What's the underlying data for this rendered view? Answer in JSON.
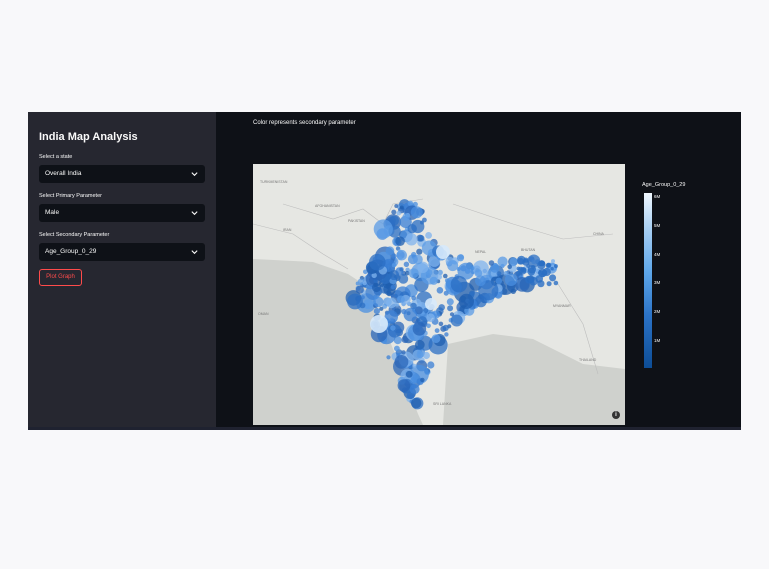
{
  "sidebar": {
    "title": "India Map Analysis",
    "state_label": "Select a state",
    "state_value": "Overall India",
    "primary_label": "Select Primary Parameter",
    "primary_value": "Male",
    "secondary_label": "Select Secondary Parameter",
    "secondary_value": "Age_Group_0_29",
    "plot_button": "Plot Graph"
  },
  "main": {
    "caption": "Color represents secondary parameter",
    "legend_title": "Age_Group_0_29",
    "colorbar_ticks": [
      "6M",
      "5M",
      "4M",
      "3M",
      "2M",
      "1M"
    ],
    "map_labels": [
      "TURKMENISTAN",
      "AFGHANISTAN",
      "IRAN",
      "PAKISTAN",
      "NEPAL",
      "BHUTAN",
      "CHINA",
      "MYANMAR",
      "THAILAND",
      "OMAN",
      "SRI LANKA"
    ],
    "info_glyph": "i"
  },
  "colors": {
    "sidebar_bg": "#262730",
    "main_bg": "#0e1117",
    "accent": "#ff4b4b",
    "bubble": "#3a7fd5"
  },
  "icons": {
    "chevron": "chevron-down-icon",
    "info": "info-icon"
  }
}
